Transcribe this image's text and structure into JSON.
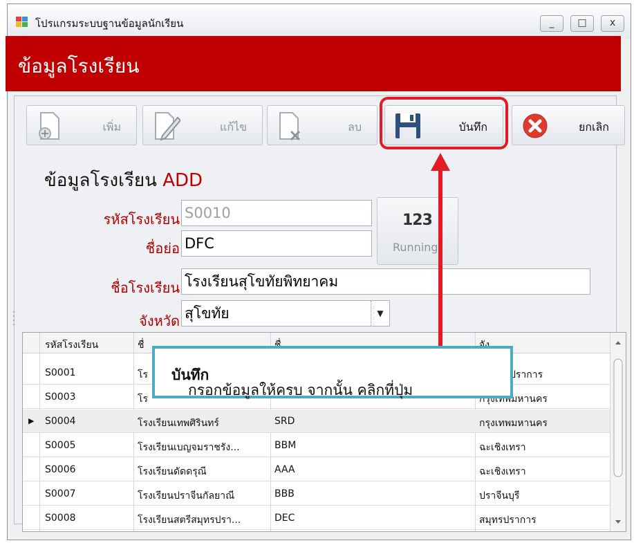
{
  "window": {
    "title": "โปรแกรมระบบฐานข้อมูลนักเรียน",
    "controls": [
      "_",
      "□",
      "x"
    ]
  },
  "header": {
    "title": "ข้อมูลโรงเรียน"
  },
  "toolbar": {
    "add_label": "เพิ่ม",
    "edit_label": "แก้ไข",
    "delete_label": "ลบ",
    "save_label": "บันทึก",
    "cancel_label": "ยกเลิก"
  },
  "form": {
    "title": "ข้อมูลโรงเรียน",
    "mode": "ADD",
    "code_label": "รหัสโรงเรียน",
    "code_value": "S0010",
    "abbr_label": "ชื่อย่อ",
    "abbr_value": "DFC",
    "name_label": "ชื่อโรงเรียน",
    "name_value": "โรงเรียนสุโขทัยพิทยาคม",
    "province_label": "จังหวัด",
    "province_value": "สุโขทัย",
    "running_top": "123",
    "running_label": "Running"
  },
  "grid": {
    "headers": [
      "รหัสโรงเรียน",
      "ชื่",
      "ชื่",
      "จัง"
    ],
    "selected_marker": "▶",
    "rows": [
      {
        "code": "S0001",
        "name": "โร",
        "abbr": "",
        "province": "ปราการ"
      },
      {
        "code": "S0003",
        "name": "โร",
        "abbr": "",
        "province": "กรุงเทพมหานคร"
      },
      {
        "code": "S0004",
        "name": "โรงเรียนเทพศิรินทร์",
        "abbr": "SRD",
        "province": "กรุงเทพมหานคร"
      },
      {
        "code": "S0005",
        "name": "โรงเรียนเบญจมราชรัง...",
        "abbr": "BBM",
        "province": "ฉะเชิงเทรา"
      },
      {
        "code": "S0006",
        "name": "โรงเรียนดัดดรุณี",
        "abbr": "AAA",
        "province": "ฉะเชิงเทรา"
      },
      {
        "code": "S0007",
        "name": "โรงเรียนปราจีนกัลยาณี",
        "abbr": "BBB",
        "province": "ปราจีนบุรี"
      },
      {
        "code": "S0008",
        "name": "โรงเรียนสตรีสมุทรปรา...",
        "abbr": "DEC",
        "province": "สมุทรปราการ"
      }
    ]
  },
  "callout": {
    "text": "กรอกข้อมูลให้ครบ จากนั้น คลิกที่ปุ่ม ",
    "bold": "บันทึก"
  },
  "colors": {
    "header_bg": "#c00000",
    "highlight": "#e21b24",
    "callout_border": "#4bacc6"
  }
}
